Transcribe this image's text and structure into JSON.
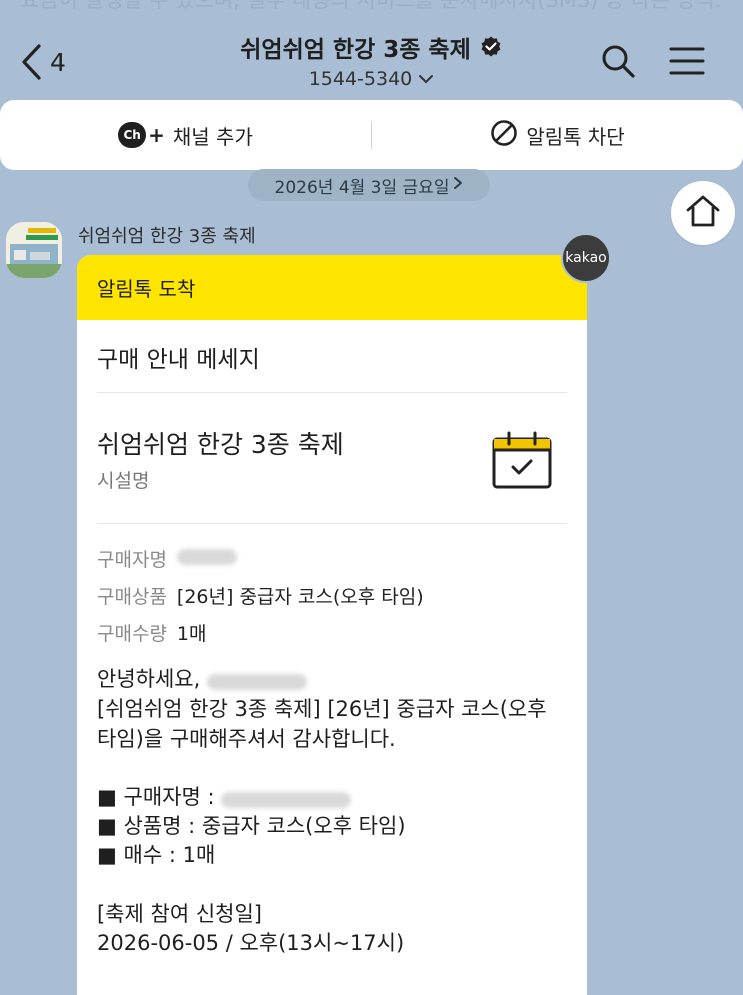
{
  "background_notice": "요금이 발생할 수 있으며, 일부 내용의 서비스를 문자메시지(SMS) 등 다른 방식으로 수신하시려면 '알림톡 차단'을 눌러 주세요.",
  "header": {
    "back_count": "4",
    "title": "쉬엄쉬엄 한강 3종 축제",
    "phone": "1544-5340",
    "verified_icon": "verified-badge-icon",
    "search_icon": "search-icon",
    "menu_icon": "menu-icon"
  },
  "channel_bar": {
    "add_channel_label": "채널 추가",
    "block_label": "알림톡 차단"
  },
  "date_divider": "2026년 4월 3일 금요일",
  "sender": {
    "name": "쉬엄쉬엄 한강 3종 축제"
  },
  "badge": "kakao",
  "message": {
    "header": "알림톡 도착",
    "section_title": "구매 안내 메세지",
    "facility_name": "쉬엄쉬엄 한강 3종 축제",
    "facility_label": "시설명",
    "fields": [
      {
        "label": "구매자명",
        "value": ""
      },
      {
        "label": "구매상품",
        "value": "[26년] 중급자 코스(오후 타임)"
      },
      {
        "label": "구매수량",
        "value": "1매"
      }
    ],
    "greeting": "안녕하세요,",
    "body_line2": "[쉬엄쉬엄 한강 3종 축제] [26년] 중급자 코스(오후",
    "body_line3": "타임)을 구매해주셔서 감사합니다.",
    "bullet_buyer": "■ 구매자명 :",
    "bullet_product": "■ 상품명 : 중급자 코스(오후 타임)",
    "bullet_count": "■ 매수 : 1매",
    "apply_date_label": "[축제 참여 신청일]",
    "apply_date_value": "2026-06-05 / 오후(13시~17시)"
  },
  "colors": {
    "chat_background": "#a9bed4",
    "kakao_yellow": "#fee500"
  }
}
